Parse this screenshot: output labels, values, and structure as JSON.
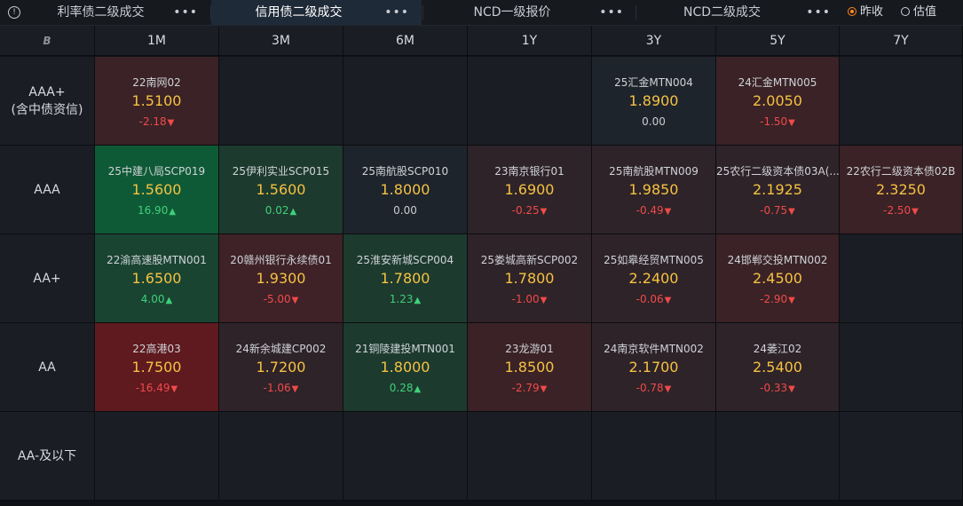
{
  "tabs": [
    {
      "label": "利率债二级成交",
      "active": false
    },
    {
      "label": "信用债二级成交",
      "active": true
    },
    {
      "label": "NCD一级报价",
      "active": false
    },
    {
      "label": "NCD二级成交",
      "active": false
    }
  ],
  "more_label": "•••",
  "options": [
    {
      "label": "昨收",
      "checked": true
    },
    {
      "label": "估值",
      "checked": false
    }
  ],
  "logo": "B",
  "columns": [
    "1M",
    "3M",
    "6M",
    "1Y",
    "3Y",
    "5Y",
    "7Y"
  ],
  "rows": [
    "AAA+\n(含中债资信)",
    "AAA",
    "AA+",
    "AA",
    "AA-及以下"
  ],
  "cells": [
    [
      {
        "name": "22南网02",
        "rate": "1.5100",
        "chg": "-2.18",
        "dir": "down",
        "bg": "#3a2226"
      },
      null,
      null,
      null,
      {
        "name": "25汇金MTN004",
        "rate": "1.8900",
        "chg": "0.00",
        "dir": "flat",
        "bg": "#1e242c"
      },
      {
        "name": "24汇金MTN005",
        "rate": "2.0050",
        "chg": "-1.50",
        "dir": "down",
        "bg": "#3a2226"
      },
      null
    ],
    [
      {
        "name": "25中建八局SCP019",
        "rate": "1.5600",
        "chg": "16.90",
        "dir": "up",
        "bg": "#0f5a36"
      },
      {
        "name": "25伊利实业SCP015",
        "rate": "1.5600",
        "chg": "0.02",
        "dir": "up",
        "bg": "#1d3a2e"
      },
      {
        "name": "25南航股SCP010",
        "rate": "1.8000",
        "chg": "0.00",
        "dir": "flat",
        "bg": "#1e242c"
      },
      {
        "name": "23南京银行01",
        "rate": "1.6900",
        "chg": "-0.25",
        "dir": "down",
        "bg": "#2e2328"
      },
      {
        "name": "25南航股MTN009",
        "rate": "1.9850",
        "chg": "-0.49",
        "dir": "down",
        "bg": "#2e2328"
      },
      {
        "name": "25农行二级资本债03A(...",
        "rate": "2.1925",
        "chg": "-0.75",
        "dir": "down",
        "bg": "#2e2328"
      },
      {
        "name": "22农行二级资本债02B",
        "rate": "2.3250",
        "chg": "-2.50",
        "dir": "down",
        "bg": "#3a2226"
      }
    ],
    [
      {
        "name": "22渝高速股MTN001",
        "rate": "1.6500",
        "chg": "4.00",
        "dir": "up",
        "bg": "#1a4432"
      },
      {
        "name": "20赣州银行永续债01",
        "rate": "1.9300",
        "chg": "-5.00",
        "dir": "down",
        "bg": "#3e2227"
      },
      {
        "name": "25淮安新城SCP004",
        "rate": "1.7800",
        "chg": "1.23",
        "dir": "up",
        "bg": "#1d3a2e"
      },
      {
        "name": "25娄城高新SCP002",
        "rate": "1.7800",
        "chg": "-1.00",
        "dir": "down",
        "bg": "#2e2328"
      },
      {
        "name": "25如皋经贸MTN005",
        "rate": "2.2400",
        "chg": "-0.06",
        "dir": "down",
        "bg": "#2e2328"
      },
      {
        "name": "24邯郸交投MTN002",
        "rate": "2.4500",
        "chg": "-2.90",
        "dir": "down",
        "bg": "#3a2226"
      },
      null
    ],
    [
      {
        "name": "22高港03",
        "rate": "1.7500",
        "chg": "-16.49",
        "dir": "down",
        "bg": "#5e1a1f"
      },
      {
        "name": "24新余城建CP002",
        "rate": "1.7200",
        "chg": "-1.06",
        "dir": "down",
        "bg": "#2e2328"
      },
      {
        "name": "21铜陵建投MTN001",
        "rate": "1.8000",
        "chg": "0.28",
        "dir": "up",
        "bg": "#1d3a2e"
      },
      {
        "name": "23龙游01",
        "rate": "1.8500",
        "chg": "-2.79",
        "dir": "down",
        "bg": "#3a2226"
      },
      {
        "name": "24南京软件MTN002",
        "rate": "2.1700",
        "chg": "-0.78",
        "dir": "down",
        "bg": "#2e2328"
      },
      {
        "name": "24萎江02",
        "rate": "2.5400",
        "chg": "-0.33",
        "dir": "down",
        "bg": "#2e2328"
      },
      null
    ],
    [
      null,
      null,
      null,
      null,
      null,
      null,
      null
    ]
  ],
  "colors": {
    "rate": "#f5c242",
    "up": "#3fd07a",
    "down": "#f04a4a",
    "empty": "#1a1d23"
  }
}
